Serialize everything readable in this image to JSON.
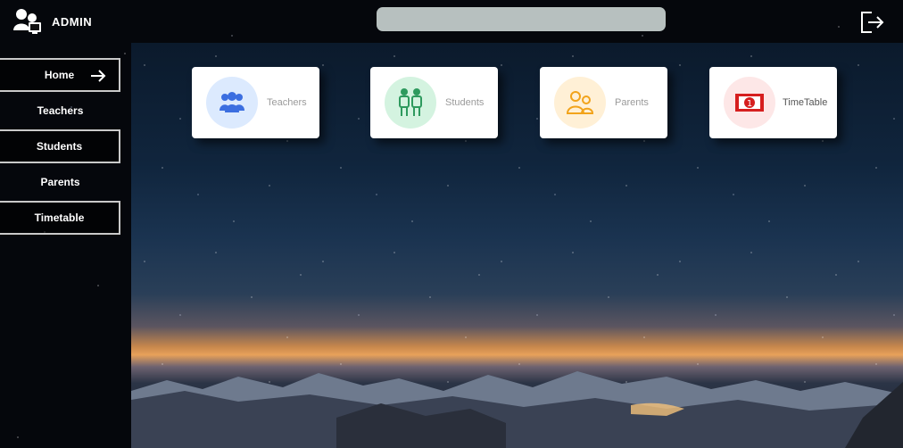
{
  "header": {
    "title": "ADMIN",
    "search_placeholder": "",
    "search_value": ""
  },
  "sidebar": {
    "items": [
      {
        "label": "Home",
        "active": true
      },
      {
        "label": "Teachers"
      },
      {
        "label": "Students"
      },
      {
        "label": "Parents"
      },
      {
        "label": "Timetable"
      }
    ]
  },
  "cards": [
    {
      "label": "Teachers",
      "icon": "teachers-icon",
      "circle_color": "#dceafe",
      "icon_color": "#3b6ee0"
    },
    {
      "label": "Students",
      "icon": "students-icon",
      "circle_color": "#d4f3e0",
      "icon_color": "#2e9a5e"
    },
    {
      "label": "Parents",
      "icon": "parents-icon",
      "circle_color": "#fff0d6",
      "icon_color": "#f2a31a"
    },
    {
      "label": "TimeTable",
      "icon": "timetable-icon",
      "circle_color": "#fde7e7",
      "icon_color": "#d61f1f"
    }
  ]
}
